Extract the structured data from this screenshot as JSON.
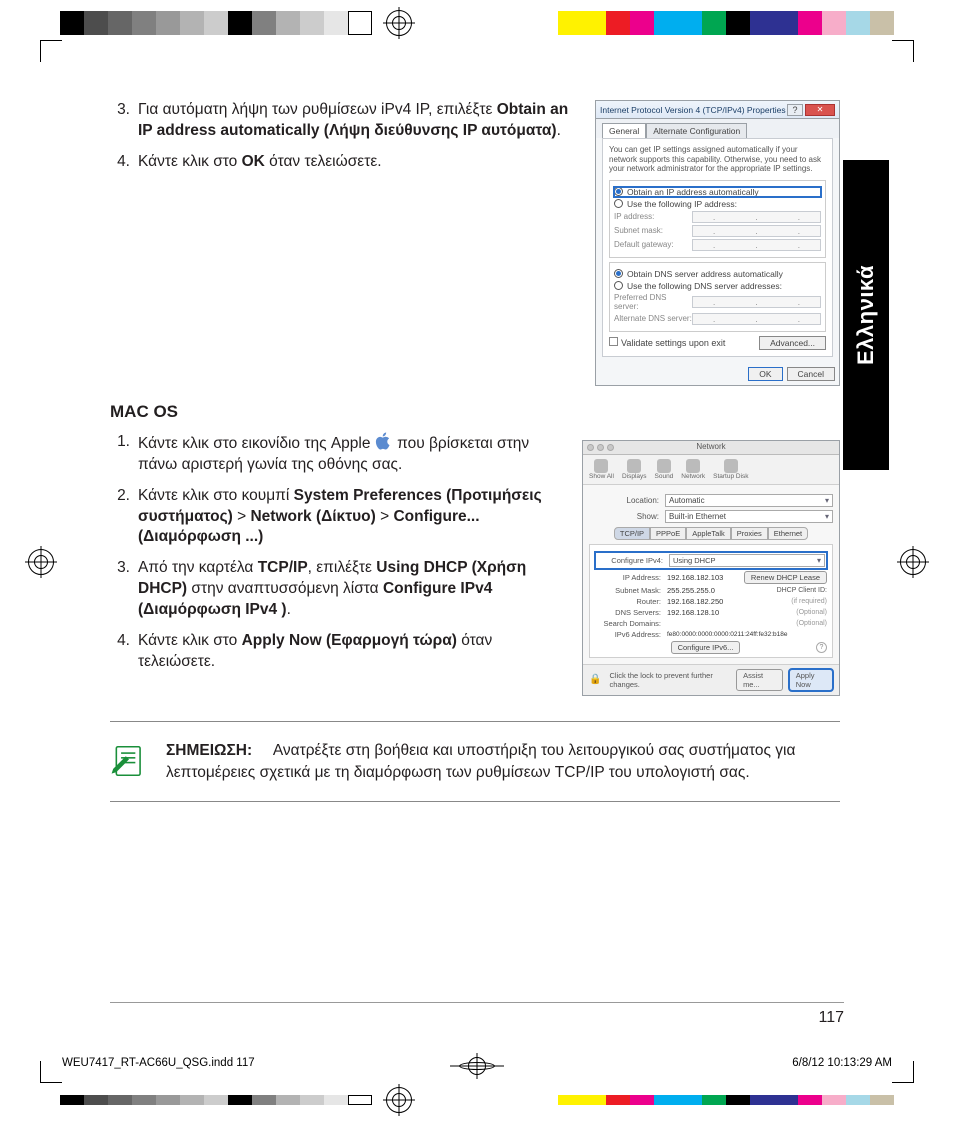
{
  "language_tab": "Ελληνικά",
  "page_number": "117",
  "slug": {
    "file": "WEU7417_RT-AC66U_QSG.indd   117",
    "datetime": "6/8/12   10:13:29 AM"
  },
  "section1": {
    "items": [
      {
        "n": "3.",
        "pre": "Για αυτόματη λήψη των ρυθμίσεων iPv4 IP, επιλέξτε ",
        "bold": "Obtain an IP address automatically (Λήψη διεύθυνσης IP αυτόματα)",
        "post": "."
      },
      {
        "n": "4.",
        "pre": "Κάντε κλικ στο ",
        "bold": "OK",
        "post": " όταν τελειώσετε."
      }
    ]
  },
  "macos_heading": "MAC OS",
  "section2": {
    "items": [
      {
        "n": "1.",
        "pre": "Κάντε κλικ στο εικονίδιο της Apple ",
        "post": " που βρίσκεται στην πάνω αριστερή γωνία της οθόνης σας."
      },
      {
        "n": "2.",
        "pre": "Κάντε κλικ στο κουμπί  ",
        "b1": "System Preferences (Προτιμήσεις συστήματος)",
        "gt1": " > ",
        "b2": "Network (Δίκτυο)",
        "gt2": " > ",
        "b3": "Configure... (Διαμόρφωση ...)"
      },
      {
        "n": "3.",
        "pre": "Από την καρτέλα ",
        "b1": "TCP/IP",
        "mid": ", επιλέξτε ",
        "b2": "Using DHCP (Χρήση DHCP)",
        "mid2": " στην αναπτυσσόμενη λίστα ",
        "b3": "Configure IPv4 (Διαμόρφωση IPv4 )",
        "post": "."
      },
      {
        "n": "4.",
        "pre": "Κάντε κλικ στο ",
        "b1": "Apply Now (Εφαρμογή τώρα)",
        "post": " όταν τελειώσετε."
      }
    ]
  },
  "note": {
    "label": "ΣΗΜΕΙΩΣΗ:",
    "text": "Ανατρέξτε στη βοήθεια και υποστήριξη του λειτουργικού σας συστήματος για λεπτομέρειες σχετικά με τη διαμόρφωση των ρυθμίσεων TCP/IP του υπολογιστή σας."
  },
  "win_dialog": {
    "title": "Internet Protocol Version 4 (TCP/IPv4) Properties",
    "tabs": [
      "General",
      "Alternate Configuration"
    ],
    "desc": "You can get IP settings assigned automatically if your network supports this capability. Otherwise, you need to ask your network administrator for the appropriate IP settings.",
    "opt_auto_ip": "Obtain an IP address automatically",
    "opt_static_ip": "Use the following IP address:",
    "f_ip": "IP address:",
    "f_mask": "Subnet mask:",
    "f_gw": "Default gateway:",
    "opt_auto_dns": "Obtain DNS server address automatically",
    "opt_static_dns": "Use the following DNS server addresses:",
    "f_pdns": "Preferred DNS server:",
    "f_adns": "Alternate DNS server:",
    "chk_validate": "Validate settings upon exit",
    "btn_adv": "Advanced...",
    "btn_ok": "OK",
    "btn_cancel": "Cancel"
  },
  "mac_dialog": {
    "title": "Network",
    "tools": [
      "Show All",
      "Displays",
      "Sound",
      "Network",
      "Startup Disk"
    ],
    "loc_label": "Location:",
    "loc_value": "Automatic",
    "show_label": "Show:",
    "show_value": "Built-in Ethernet",
    "tabs": [
      "TCP/IP",
      "PPPoE",
      "AppleTalk",
      "Proxies",
      "Ethernet"
    ],
    "cfg_label": "Configure IPv4:",
    "cfg_value": "Using DHCP",
    "fields": {
      "ip": {
        "l": "IP Address:",
        "v": "192.168.182.103"
      },
      "mask": {
        "l": "Subnet Mask:",
        "v": "255.255.255.0"
      },
      "router": {
        "l": "Router:",
        "v": "192.168.182.250"
      },
      "dns": {
        "l": "DNS Servers:",
        "v": "192.168.128.10"
      },
      "search": {
        "l": "Search Domains:",
        "v": ""
      },
      "ipv6": {
        "l": "IPv6 Address:",
        "v": "fe80:0000:0000:0000:0211:24ff:fe32:b18e"
      }
    },
    "renew": "Renew DHCP Lease",
    "client_l": "DHCP Client ID:",
    "client_hint": "(if required)",
    "optional": "(Optional)",
    "cfg6": "Configure IPv6...",
    "lock_text": "Click the lock to prevent further changes.",
    "assist": "Assist me...",
    "apply": "Apply Now"
  }
}
